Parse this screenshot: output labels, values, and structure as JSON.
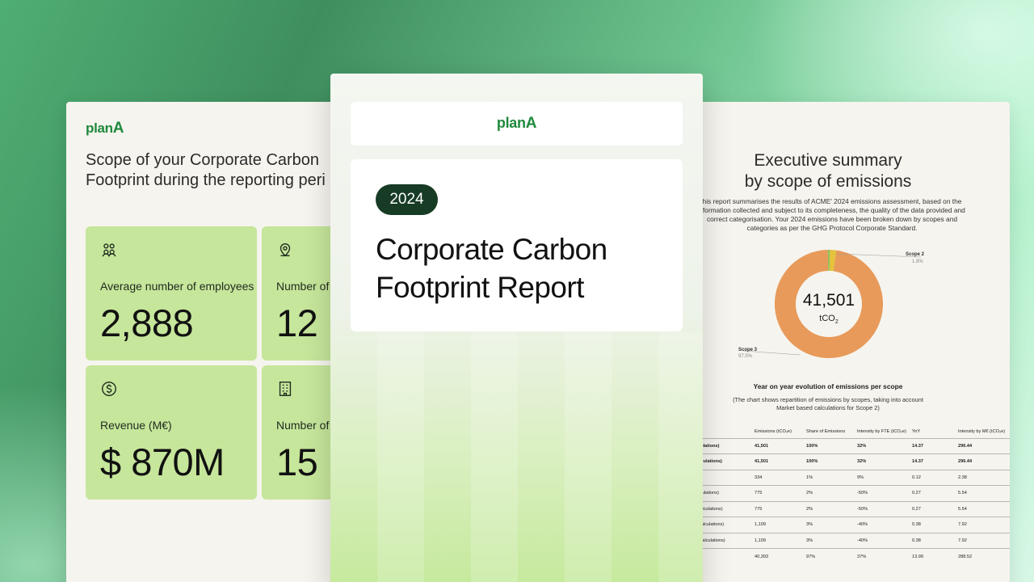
{
  "brand": {
    "logo_text": "plan",
    "logo_accent": "A",
    "accent_color": "#1f8a3d",
    "card_color": "#c6e69b",
    "pill_color": "#173b24"
  },
  "left_page": {
    "title_line1": "Scope of your Corporate Carbon",
    "title_line2": "Footprint during the reporting peri",
    "cards": [
      {
        "icon": "people-icon",
        "label": "Average number of employees",
        "value": "2,888"
      },
      {
        "icon": "location-pin-icon",
        "label": "Number of l",
        "value": "12"
      },
      {
        "icon": "dollar-coin-icon",
        "label": "Revenue (M€)",
        "value": "$ 870M"
      },
      {
        "icon": "building-icon",
        "label": "Number of f",
        "value": "15"
      }
    ]
  },
  "cover": {
    "year": "2024",
    "title_line1": "Corporate Carbon",
    "title_line2": "Footprint Report"
  },
  "right_page": {
    "title_line1": "Executive summary",
    "title_line2": "by scope of emissions",
    "intro": "his report summarises the results of ACME' 2024 emissions assessment, based on the nformation collected and subject to its completeness, the quality of the data provided and correct categorisation. Your 2024 emissions have been broken down by scopes and categories as per the GHG Protocol Corporate Standard.",
    "donut": {
      "center_value": "41,501",
      "center_unit": "tCO",
      "center_unit_sub": "2",
      "slices": [
        {
          "label": "Scope 2",
          "pct_label": "1.9%",
          "value": 1.9,
          "color": "#e5c23c"
        },
        {
          "label": "Scope 3",
          "pct_label": "97.5%",
          "value": 97.5,
          "color": "#e89a5a"
        },
        {
          "label": "",
          "pct_label": "",
          "value": 0.6,
          "color": "#8fbf5a"
        }
      ]
    },
    "yoy_title": "Year on year evolution of emissions per scope",
    "yoy_sub": "(The chart shows repartition of emissions by  scopes, taking into account Market based calculations for Scope 2)",
    "table": {
      "headers": [
        "",
        "Emissions (tCO₂e)",
        "Share of Emissions",
        "Intensity by FTE (tCO₂e)",
        "YoY",
        "Intensity by M€ (tCO₂e)"
      ],
      "rows": [
        {
          "bold": true,
          "cells": [
            "ased calculations)",
            "41,501",
            "100%",
            "32%",
            "14.37",
            "296.44"
          ]
        },
        {
          "bold": true,
          "cells": [
            "based calculations)",
            "41,501",
            "100%",
            "32%",
            "14.37",
            "296.44"
          ]
        },
        {
          "bold": false,
          "cells": [
            "",
            "334",
            "1%",
            "9%",
            "0.12",
            "2.38"
          ]
        },
        {
          "bold": false,
          "cells": [
            "based calculations)",
            "775",
            "2%",
            "-50%",
            "0.27",
            "5.54"
          ]
        },
        {
          "bold": false,
          "cells": [
            "n based calculations)",
            "775",
            "2%",
            "-50%",
            "0.27",
            "5.54"
          ]
        },
        {
          "bold": false,
          "cells": [
            "et based calculations)",
            "1,109",
            "3%",
            "-40%",
            "0.38",
            "7.92"
          ]
        },
        {
          "bold": false,
          "cells": [
            "on based calculations)",
            "1,109",
            "3%",
            "-40%",
            "0.38",
            "7.92"
          ]
        },
        {
          "bold": false,
          "cells": [
            "",
            "40,393",
            "97%",
            "37%",
            "13.99",
            "288.52"
          ]
        }
      ]
    }
  }
}
